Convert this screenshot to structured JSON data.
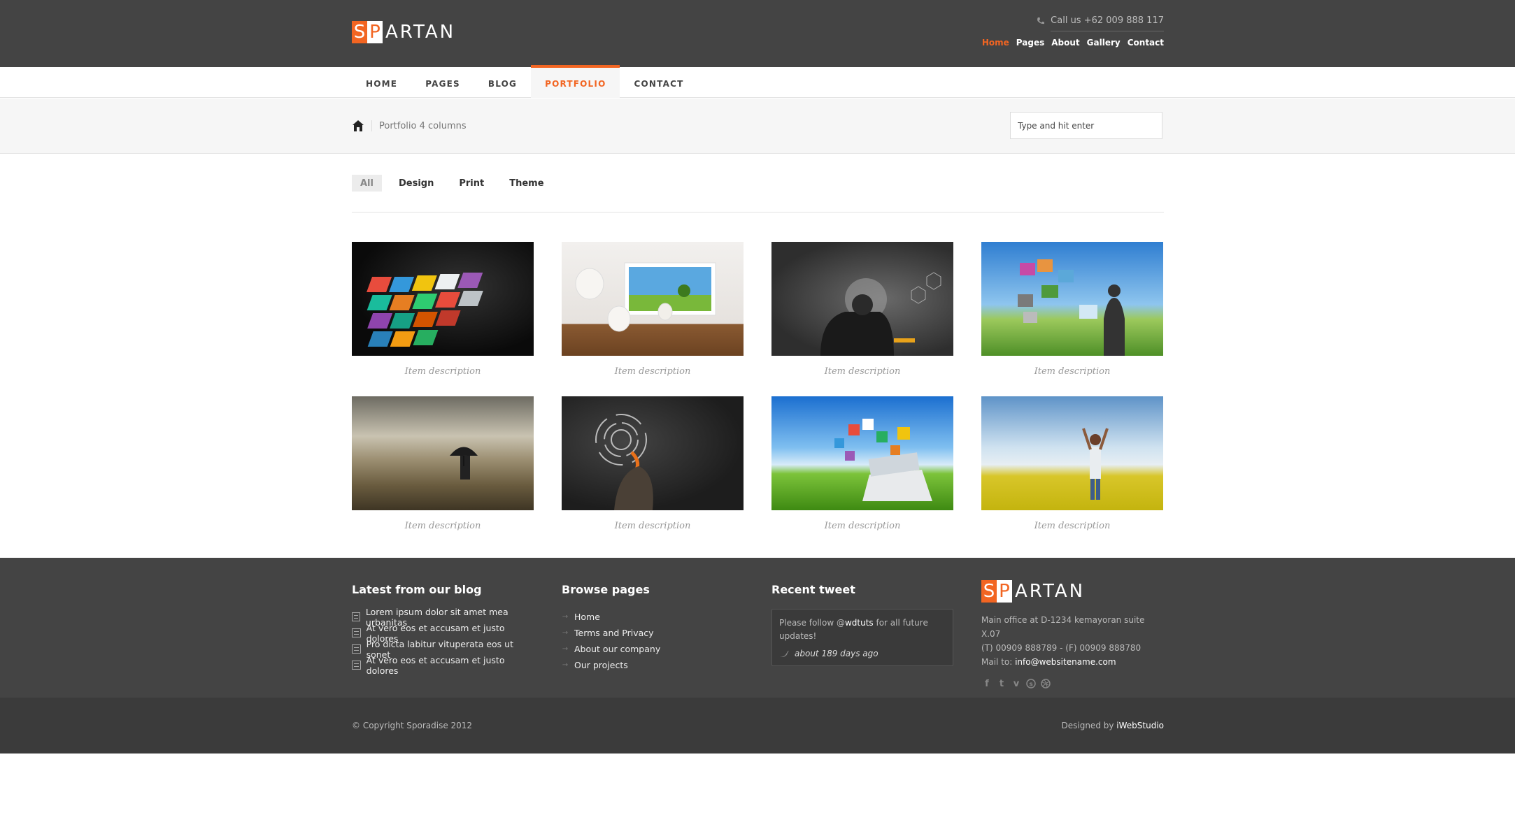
{
  "brand": {
    "logo_box1": "S",
    "logo_box2": "P",
    "logo_rest": "ARTAN"
  },
  "header": {
    "phone": "Call us +62 009 888 117",
    "top_links": [
      {
        "label": "Home",
        "active": true
      },
      {
        "label": "Pages",
        "active": false
      },
      {
        "label": "About",
        "active": false
      },
      {
        "label": "Gallery",
        "active": false
      },
      {
        "label": "Contact",
        "active": false
      }
    ]
  },
  "nav": {
    "items": [
      {
        "label": "HOME"
      },
      {
        "label": "PAGES"
      },
      {
        "label": "BLOG"
      },
      {
        "label": "PORTFOLIO",
        "active": true
      },
      {
        "label": "CONTACT"
      }
    ]
  },
  "breadcrumb": {
    "current": "Portfolio 4 columns"
  },
  "search": {
    "placeholder": "Type and hit enter"
  },
  "filters": [
    {
      "label": "All",
      "active": true
    },
    {
      "label": "Design"
    },
    {
      "label": "Print"
    },
    {
      "label": "Theme"
    }
  ],
  "portfolio": {
    "items": [
      {
        "caption": "Item description"
      },
      {
        "caption": "Item description"
      },
      {
        "caption": "Item description"
      },
      {
        "caption": "Item description"
      },
      {
        "caption": "Item description"
      },
      {
        "caption": "Item description"
      },
      {
        "caption": "Item description"
      },
      {
        "caption": "Item description"
      }
    ]
  },
  "footer": {
    "blog": {
      "title": "Latest from our blog",
      "posts": [
        "Lorem ipsum dolor sit amet mea urbanitas",
        "At vero eos et accusam et justo dolores",
        "Pro dicta labitur vituperata eos ut sonet",
        "At vero eos et accusam et justo dolores"
      ]
    },
    "browse": {
      "title": "Browse pages",
      "links": [
        "Home",
        "Terms and Privacy",
        "About our company",
        "Our projects"
      ]
    },
    "tweet": {
      "title": "Recent tweet",
      "text_before": "Please follow @",
      "user": "wdtuts",
      "text_after": " for all future updates!",
      "time": "about 189 days ago"
    },
    "contact": {
      "address": "Main office at D-1234 kemayoran suite X.07",
      "phones": "(T) 00909 888789 - (F) 00909 888780",
      "mail_label": "Mail to: ",
      "mail": "info@websitename.com"
    },
    "copyright": "© Copyright Sporadise 2012",
    "designed_by_label": "Designed by ",
    "designed_by": "iWebStudio"
  },
  "colors": {
    "accent": "#f26522",
    "header_bg": "#444444",
    "footer_bg": "#444444"
  }
}
